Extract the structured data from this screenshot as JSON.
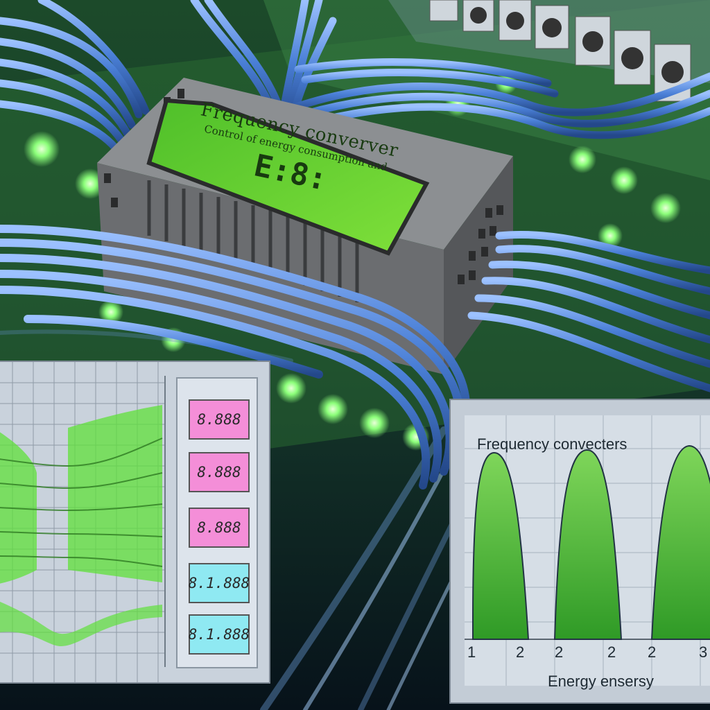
{
  "module": {
    "title": "Frequency converver",
    "subtitle": "Control of energy consumption and",
    "digits": "E:8:"
  },
  "readouts": [
    {
      "text": "8.888",
      "color": "pink"
    },
    {
      "text": "8.888",
      "color": "pink"
    },
    {
      "text": "8.888",
      "color": "pink"
    },
    {
      "text": "8.1.888",
      "color": "cyan"
    },
    {
      "text": "8.1.888",
      "color": "cyan"
    }
  ],
  "chart": {
    "title": "Frequency convecters",
    "xlabel": "Energy ensersy",
    "ticks": [
      "1",
      "2",
      "2",
      "2",
      "2",
      "3"
    ]
  },
  "colors": {
    "cable": "#4a7fd6",
    "board": "#2e8a3a",
    "led": "#8cff7a",
    "lcd": "#5fcf2a",
    "chassis": "#6b6d70",
    "wave": "#4fc62c"
  }
}
